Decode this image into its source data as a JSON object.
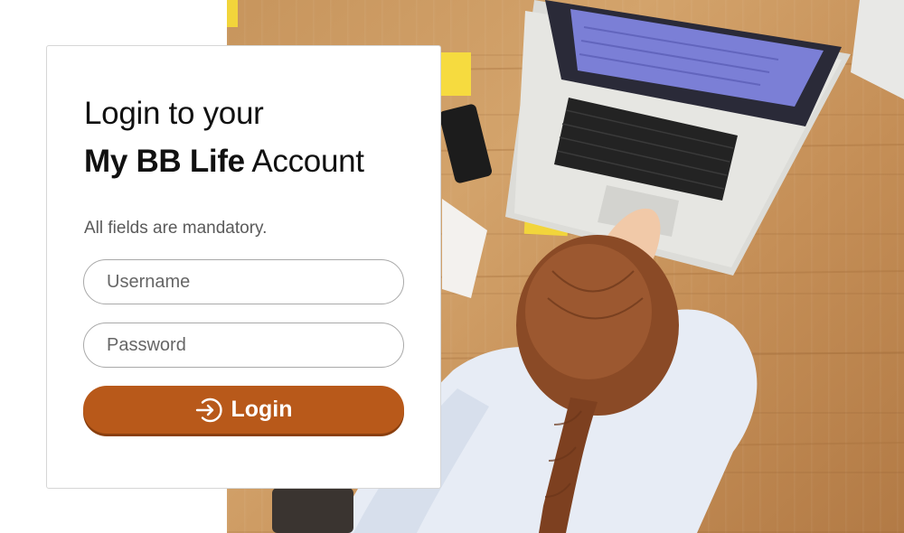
{
  "heading": {
    "line1": "Login to your",
    "brand": "My BB Life",
    "suffix": " Account"
  },
  "form": {
    "note": "All fields are mandatory.",
    "username_placeholder": "Username",
    "username_value": "",
    "password_placeholder": "Password",
    "password_value": "",
    "login_label": "Login",
    "login_icon": "sign-in-icon"
  },
  "colors": {
    "button": "#b8591a",
    "button_shadow": "#8a3f0e",
    "field_border": "#a9a9a9"
  },
  "background": {
    "description_icon": "office-desk-photo"
  }
}
